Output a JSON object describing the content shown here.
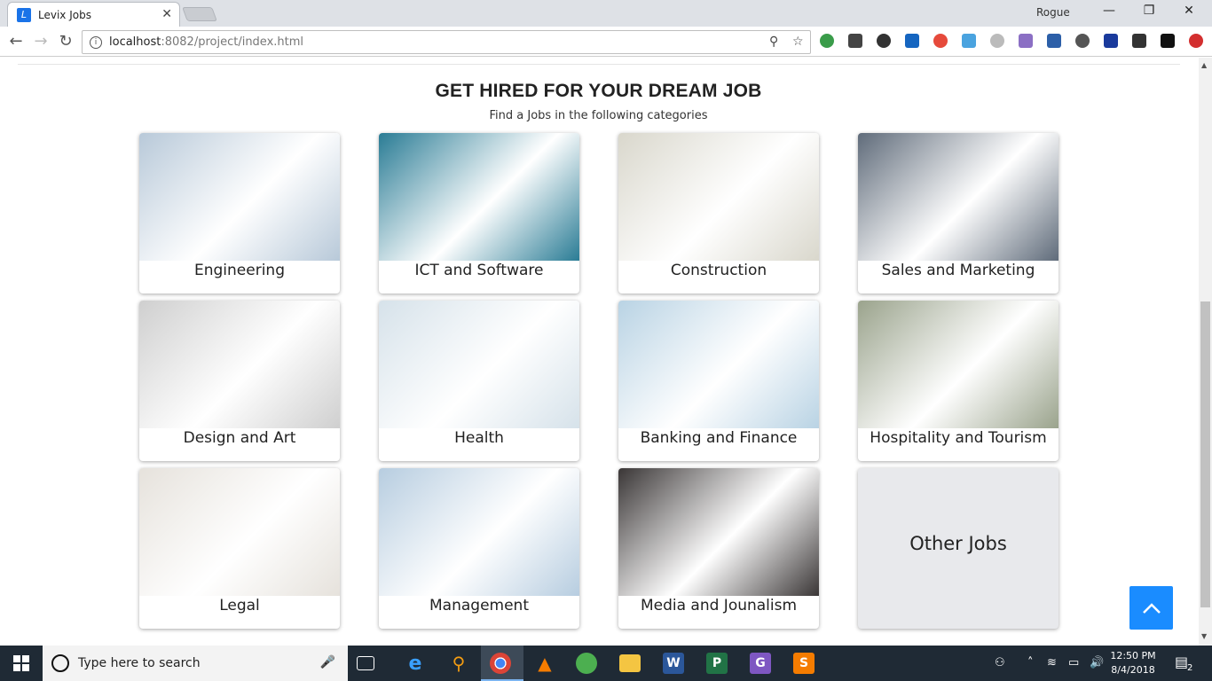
{
  "browser": {
    "tab_title": "Levix Jobs",
    "tab_favicon": "L",
    "close_glyph": "✕",
    "profile": "Rogue",
    "window_controls": {
      "minimize": "—",
      "restore": "❐",
      "close": "✕"
    },
    "url_host": "localhost",
    "url_path": ":8082/project/index.html",
    "info_glyph": "i",
    "zoom_glyph": "⚲",
    "star_glyph": "☆",
    "back_glyph": "←",
    "forward_glyph": "→",
    "reload_glyph": "↻"
  },
  "page": {
    "title": "GET HIRED FOR YOUR DREAM JOB",
    "subtitle": "Find a Jobs in the following categories",
    "categories": [
      {
        "label": "Engineering",
        "color": "#b8c9d9"
      },
      {
        "label": "ICT and Software",
        "color": "#2a7c95"
      },
      {
        "label": "Construction",
        "color": "#d9d7cc"
      },
      {
        "label": "Sales and Marketing",
        "color": "#5f6b7a"
      },
      {
        "label": "Design and Art",
        "color": "#cfcfcf"
      },
      {
        "label": "Health",
        "color": "#d6e2ea"
      },
      {
        "label": "Banking and Finance",
        "color": "#b9d3e4"
      },
      {
        "label": "Hospitality and Tourism",
        "color": "#9aa38c"
      },
      {
        "label": "Legal",
        "color": "#e6e2dc"
      },
      {
        "label": "Management",
        "color": "#b7cde0"
      },
      {
        "label": "Media and Jounalism",
        "color": "#3a3636"
      },
      {
        "label": "Other Jobs",
        "color": "#e8e9ec"
      }
    ]
  },
  "taskbar": {
    "search_placeholder": "Type here to search",
    "time": "12:50 PM",
    "date": "8/4/2018",
    "notifications": "2"
  }
}
